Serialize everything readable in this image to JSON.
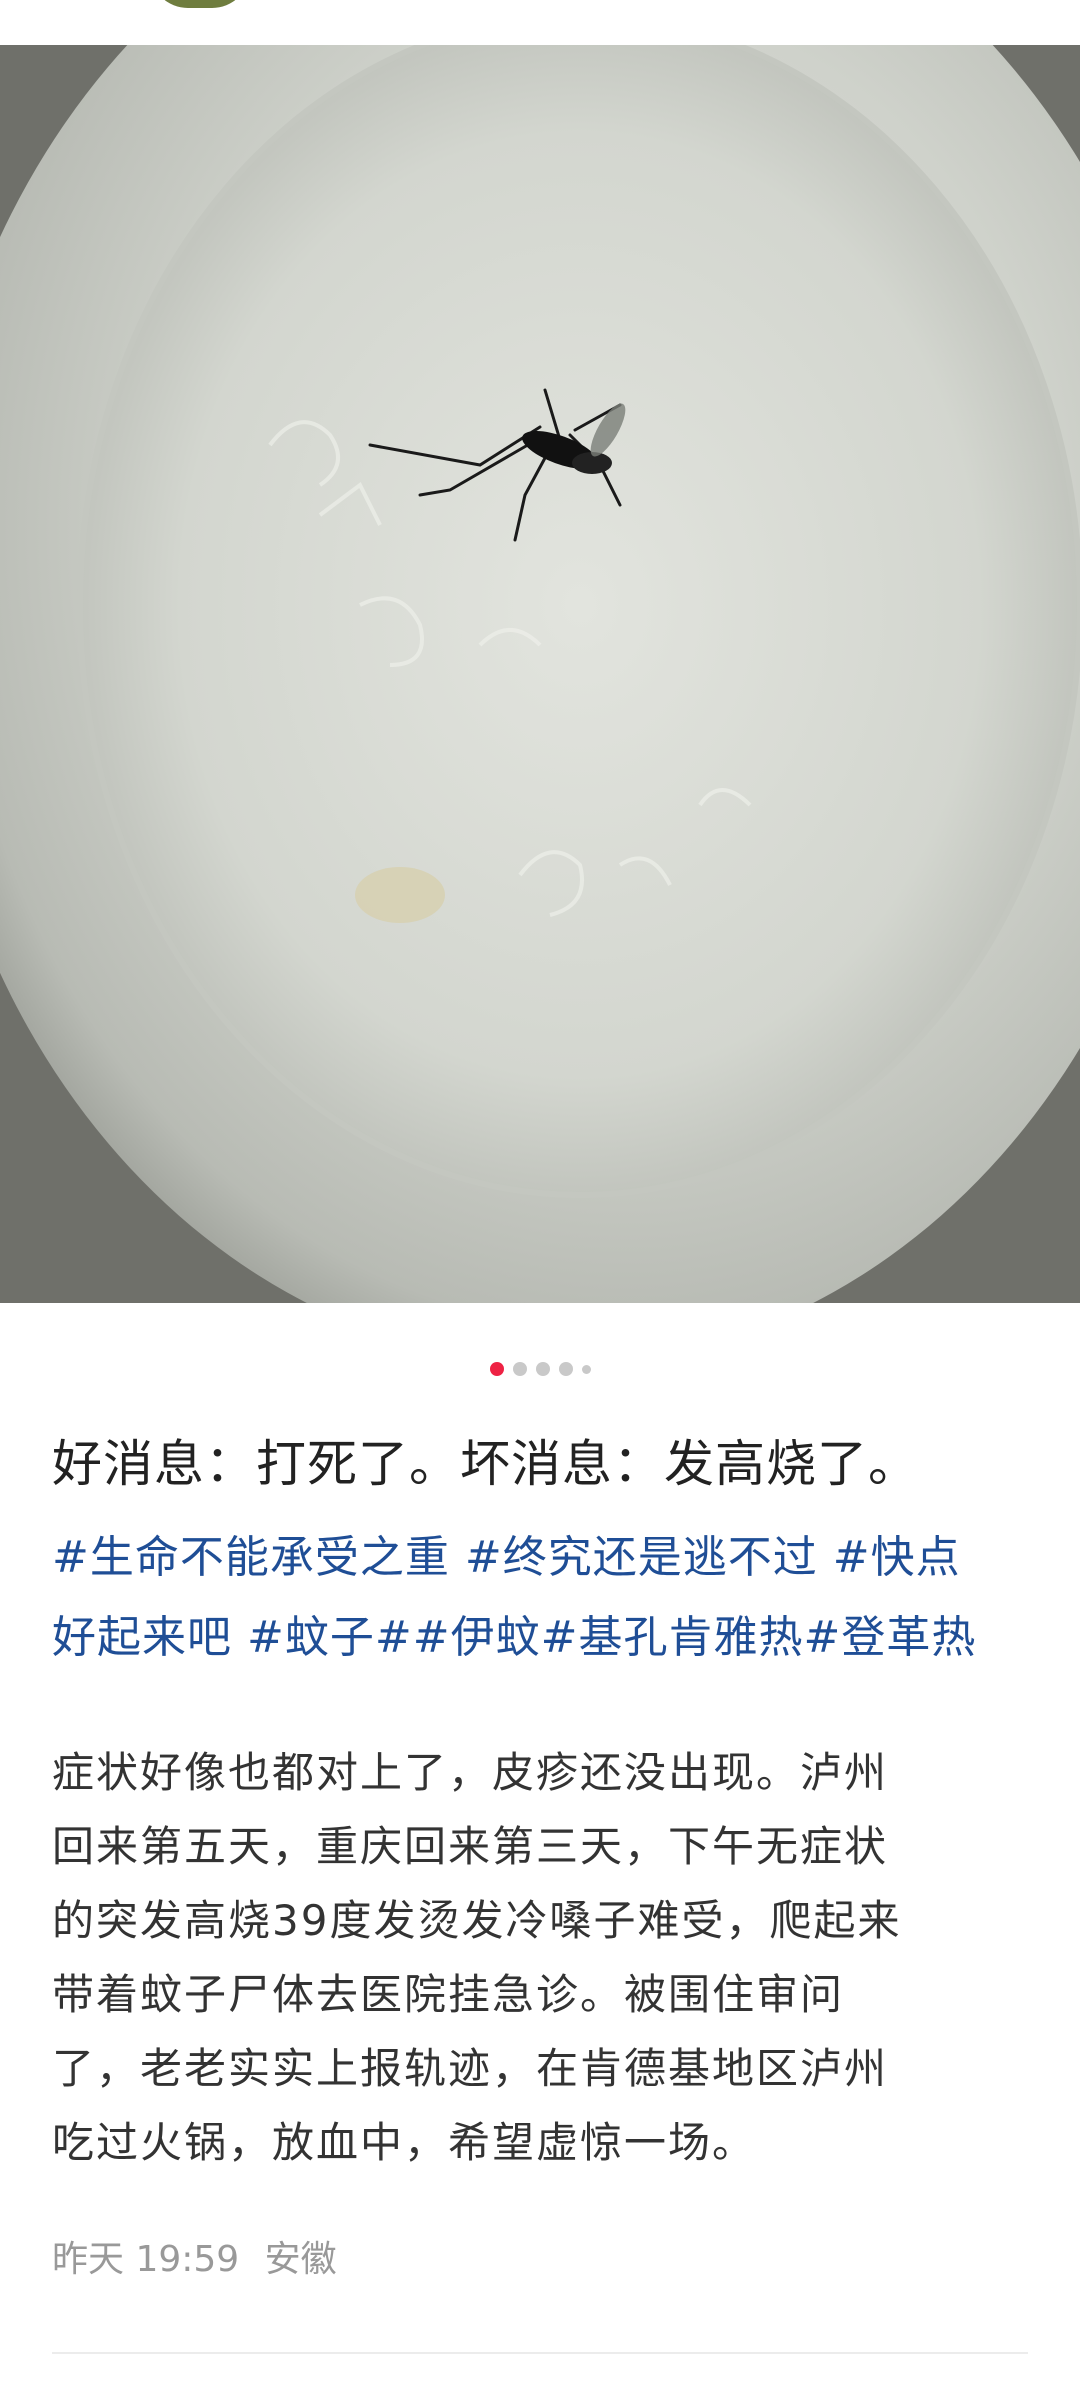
{
  "post": {
    "title": "好消息：打死了。坏消息：发高烧了。",
    "tags_lines": [
      "#生命不能承受之重 #终究还是逃不过 #快点",
      "好起来吧 #蚊子##伊蚊#基孔肯雅热#登革热"
    ],
    "body_lines": [
      "症状好像也都对上了，皮疹还没出现。泸州",
      "回来第五天，重庆回来第三天，下午无症状",
      "的突发高烧39度发烫发冷嗓子难受，爬起来",
      "带着蚊子尸体去医院挂急诊。被围住审问",
      "了，老老实实上报轨迹，在肯德基地区泸州",
      "吃过火锅，放血中，希望虚惊一场。"
    ],
    "time": "昨天 19:59",
    "location": "安徽"
  },
  "carousel": {
    "total": 5,
    "current": 1
  },
  "photo": {
    "subject": "dead mosquito on a white plastic lid"
  },
  "colors": {
    "tag": "#1f4e96",
    "active_dot": "#ee2244",
    "meta": "#999999"
  }
}
